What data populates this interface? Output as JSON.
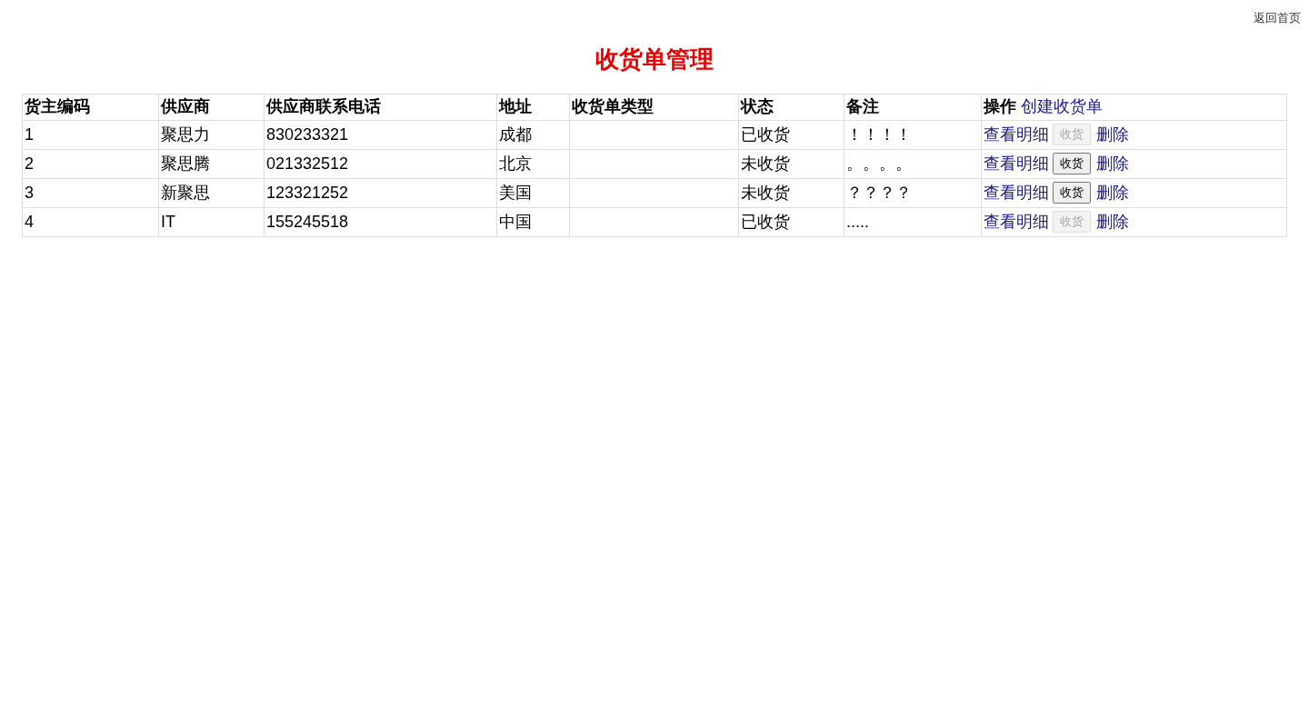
{
  "top_link": "返回首页",
  "title": "收货单管理",
  "table": {
    "columns": [
      "货主编码",
      "供应商",
      "供应商联系电话",
      "地址",
      "收货单类型",
      "状态",
      "备注",
      "操作"
    ],
    "create_link": "创建收货单",
    "rows": [
      {
        "code": "1",
        "supplier": "聚思力",
        "phone": "830233321",
        "address": "成都",
        "type": "",
        "status": "已收货",
        "remark": "！！！！",
        "detail_link": "查看明细",
        "receive_button": {
          "label": "收货",
          "disabled": true
        },
        "delete_link": "删除"
      },
      {
        "code": "2",
        "supplier": "聚思腾",
        "phone": "021332512",
        "address": "北京",
        "type": "",
        "status": "未收货",
        "remark": "。。。。",
        "detail_link": "查看明细",
        "receive_button": {
          "label": "收货",
          "disabled": false
        },
        "delete_link": "删除"
      },
      {
        "code": "3",
        "supplier": "新聚思",
        "phone": "123321252",
        "address": "美国",
        "type": "",
        "status": "未收货",
        "remark": "？？？？",
        "detail_link": "查看明细",
        "receive_button": {
          "label": "收货",
          "disabled": false
        },
        "delete_link": "删除"
      },
      {
        "code": "4",
        "supplier": "IT",
        "phone": "155245518",
        "address": "中国",
        "type": "",
        "status": "已收货",
        "remark": ".....",
        "detail_link": "查看明细",
        "receive_button": {
          "label": "收货",
          "disabled": true
        },
        "delete_link": "删除"
      }
    ]
  }
}
